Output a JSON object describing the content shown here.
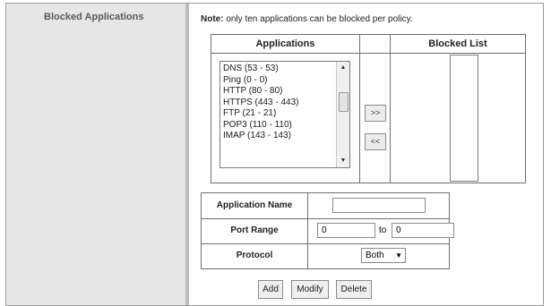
{
  "section": {
    "label": "Blocked Applications"
  },
  "note": {
    "prefix": "Note:",
    "text": " only ten applications can be blocked per policy."
  },
  "table": {
    "applications_header": "Applications",
    "blocked_header": "Blocked List",
    "move_right_label": ">>",
    "move_left_label": "<<"
  },
  "applications": [
    "DNS   (53 - 53)",
    "Ping   (0 - 0)",
    "HTTP   (80 - 80)",
    "HTTPS   (443 - 443)",
    "FTP   (21 - 21)",
    "POP3   (110 - 110)",
    "IMAP   (143 - 143)"
  ],
  "blocked_list": [],
  "form": {
    "app_name_label": "Application Name",
    "app_name_value": "",
    "port_range_label": "Port Range",
    "port_from": "0",
    "to_label": "to",
    "port_to": "0",
    "protocol_label": "Protocol",
    "protocol_value": "Both"
  },
  "buttons": {
    "add": "Add",
    "modify": "Modify",
    "delete": "Delete"
  },
  "icons": {
    "scroll_up": "scroll-up-arrow",
    "scroll_down": "scroll-down-arrow",
    "dropdown": "dropdown-arrow"
  }
}
